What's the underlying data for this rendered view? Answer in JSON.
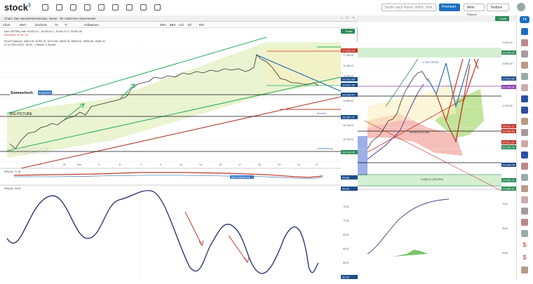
{
  "header": {
    "logo_text": "stock",
    "logo_sup": "3",
    "search_placeholder": "Suche nach Name, WKN, ISIN...",
    "premium_label": "Premium",
    "depot_label": "Mein Depot",
    "toolbox_label": "Toolbox"
  },
  "window": {
    "title": "Chart: Das Stundenbeizeichart, Reine - für ADIDADA Abonnenten",
    "toolbar": [
      "Chart",
      "Wert",
      "Zeichnen",
      "TA",
      "TI",
      "Indikatoren",
      "EMA",
      "BBS",
      "CCI",
      "Ell",
      "RSI"
    ],
    "info_line1": "DAX (XETRA) Last: 16.933,21 ↑ 16.020,01 L: 16.910,11 C: 16.931,38",
    "info_line2": "EMA(200): 16.967,43",
    "info_line3": "Pivot-Punkte(D): 15861,28, 16782,76, 16771,85, 16875,76, 16902,04, 16953,56, 16482,42",
    "info_line4": "27.11.2023 18:00 - 28.03 · 1 Monat / 1 Stunde"
  },
  "annotations": {
    "sommerhoch": "Sommerhoch",
    "sommerhoch_tag": "Ausgeschrt",
    "big_picture": "BIG PICTURE",
    "watermark": "STOCK3",
    "fraction_label": "17.002 (78.6%)",
    "fib_label": "17.003 (78.6%)",
    "fib2": "14.820,21 (100.00%)",
    "fib3": "15.991,41 (61.8%)"
  },
  "price_scale_left": [
    "17.000,00",
    "16.945,00",
    "16.900,00",
    "16.800,00",
    "16.759,00",
    "16.700,00",
    "16.750,00",
    "16.500,00",
    "16.400,00",
    "16.300,00",
    "16.200,00",
    "16.100,00",
    "16.000,00"
  ],
  "price_tags_left": [
    {
      "text": "17.020,23",
      "color": "#c0392b"
    },
    {
      "text": "16.913,58",
      "color": "#1e4f8c"
    },
    {
      "text": "16.807,30",
      "color": "#1e4f8c"
    },
    {
      "text": "16.528,97",
      "color": "#1e4f8c"
    },
    {
      "text": "16.367,71",
      "color": "#1e4f8c"
    },
    {
      "text": "16.015,00",
      "color": "#2e8b57"
    },
    {
      "text": "48,89",
      "color": "#1e4f8c"
    },
    {
      "text": "45,00",
      "color": "#1e4f8c"
    },
    {
      "text": "30,29",
      "color": "#1e4f8c"
    }
  ],
  "level_labels": {
    "kurszielt": "Kursziel",
    "unterst": "Unterstützung",
    "ziel": "Kursziele",
    "ueber": "Überkauft"
  },
  "x_dates": [
    "17",
    "20",
    "Nov",
    "3",
    "6",
    "7",
    "9",
    "10",
    "14",
    "16",
    "17",
    "20",
    "23",
    "24",
    "27",
    "28"
  ],
  "indicator1": {
    "label": "RSI(14): 77,16",
    "badge": "Short entered here"
  },
  "indicator2": {
    "label": "RSI(14): 15,09",
    "levels": [
      "80,00",
      "75,00",
      "70,00",
      "65,00",
      "60,00",
      "55,00",
      "50,00",
      "45,00",
      "40,00",
      "35,00"
    ]
  },
  "right_chart": {
    "trade_label": "Trade",
    "price_tags": [
      {
        "text": "18.000,00",
        "color": "#2e8b57"
      },
      {
        "text": "17.012,88",
        "color": "#1e4f8c"
      },
      {
        "text": "16.745,00",
        "color": "#8e44ad"
      },
      {
        "text": "16.512,12",
        "color": "#c0392b"
      },
      {
        "text": "16.093,88",
        "color": "#c0392b"
      },
      {
        "text": "15.611,25",
        "color": "#c0392b"
      },
      {
        "text": "15.308,00",
        "color": "#2e8b57"
      },
      {
        "text": "14.940,08",
        "color": "#1e4f8c"
      },
      {
        "text": "14.820,21",
        "color": "#2e8b57"
      },
      {
        "text": "14.560,83",
        "color": "#2e8b57"
      }
    ],
    "scale": [
      "19.000,00",
      "18.500,00",
      "17.500,00",
      "17.000,00",
      "16.500,00",
      "16.000,00",
      "15.500,00",
      "15.000,00",
      "14.500,00"
    ],
    "lower_scale": [
      "75,00",
      "50,00",
      "25,00",
      "0,00"
    ],
    "lbl_fib": "17.002 (78.6%)",
    "lbl_fib2": "16.993 (72.91.8%)"
  },
  "sidebar": {
    "badge": "14"
  },
  "colors": {
    "accent": "#1b6ec2",
    "uptrend": "#2e8b57",
    "downtrend": "#c0392b",
    "channel": "#27ae60",
    "resistance": "#1e4f8c"
  }
}
